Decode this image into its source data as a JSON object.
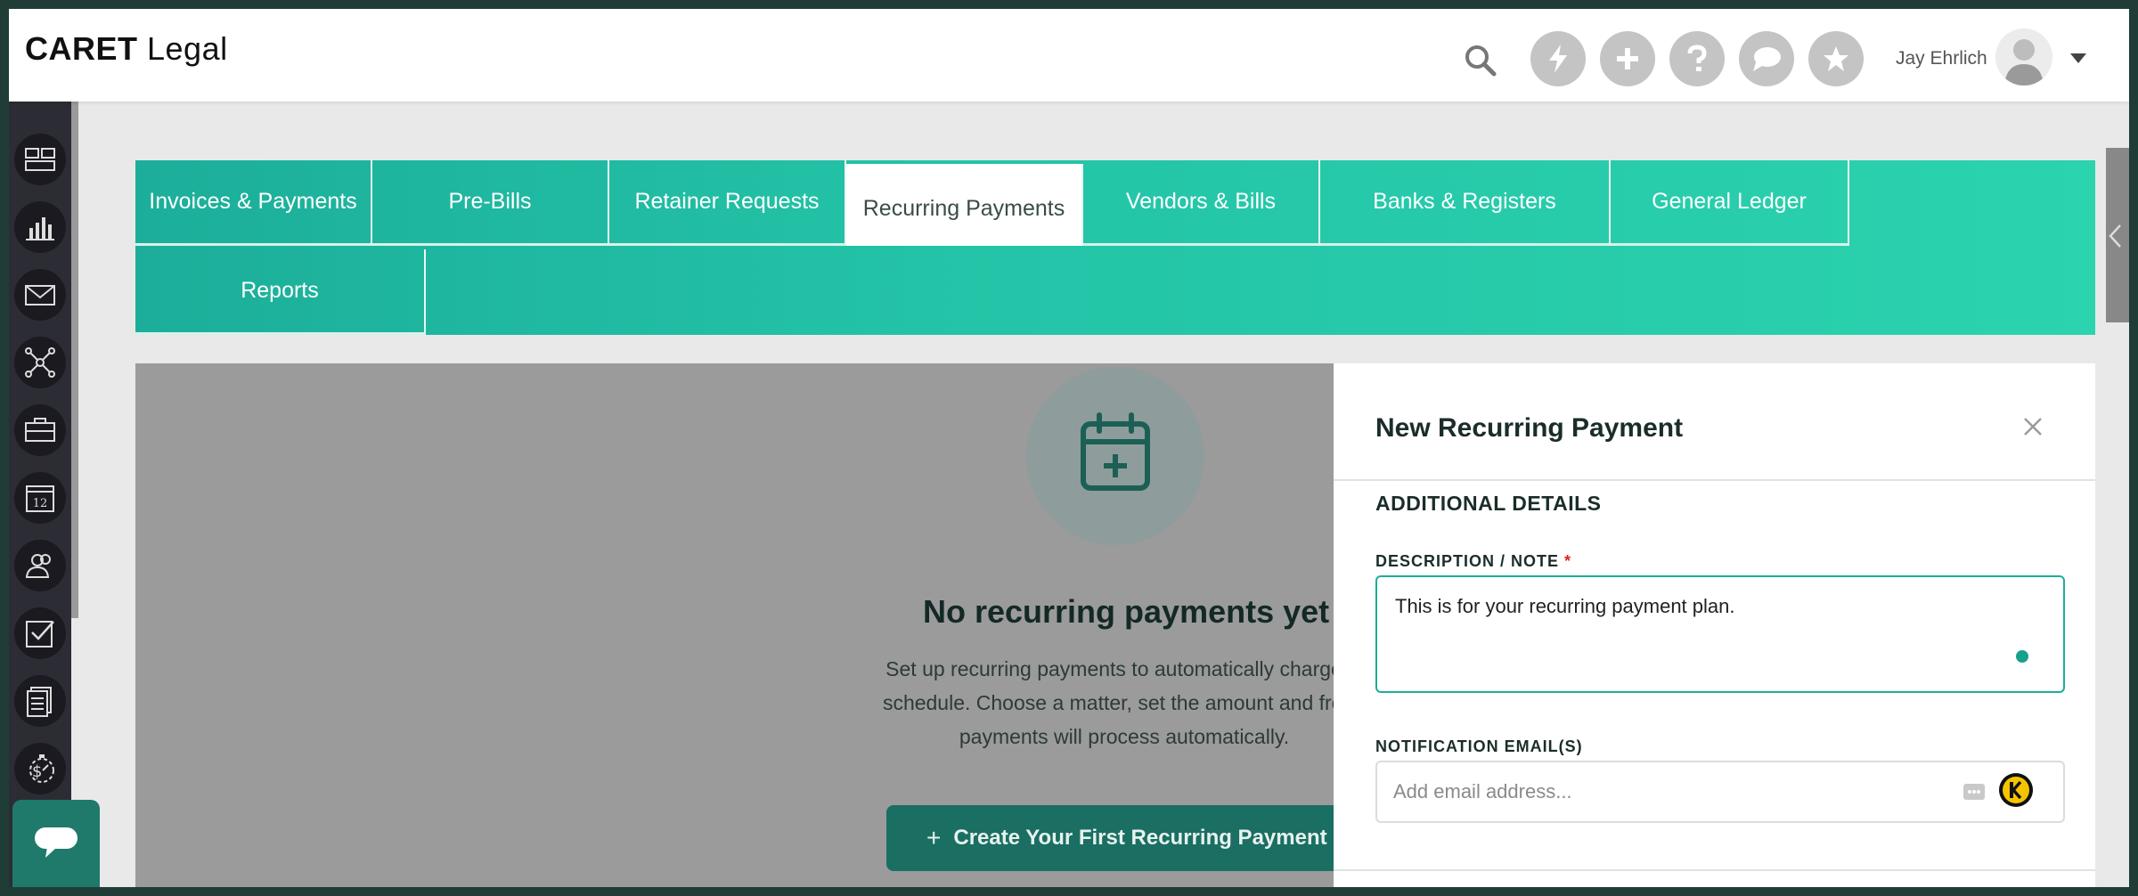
{
  "header": {
    "logo_text": "CARET Legal",
    "user_name": "Jay Ehrlich",
    "icons": [
      "search-icon",
      "lightning-icon",
      "plus-icon",
      "help-icon",
      "chat-icon",
      "star-icon"
    ]
  },
  "sidebar": {
    "items": [
      "dashboard-icon",
      "reports-chart-icon",
      "mail-icon",
      "network-icon",
      "briefcase-icon",
      "calendar-icon",
      "contacts-icon",
      "tasks-icon",
      "documents-icon",
      "billing-timer-icon"
    ],
    "calendar_day": "12"
  },
  "tabs": {
    "row1": [
      "Invoices & Payments",
      "Pre-Bills",
      "Retainer Requests",
      "Recurring Payments",
      "Vendors & Bills",
      "Banks & Registers",
      "General Ledger"
    ],
    "row2": [
      "Reports"
    ],
    "active": "Recurring Payments"
  },
  "empty_state": {
    "title": "No recurring payments yet",
    "description_lines": [
      "Set up recurring payments to automatically charge cl",
      "schedule. Choose a matter, set the amount and frequ",
      "payments will process automatically."
    ],
    "cta_label": "Create Your First Recurring Payment",
    "cta_prefix": "+"
  },
  "panel": {
    "title": "New Recurring Payment",
    "section": "ADDITIONAL DETAILS",
    "description_label": "DESCRIPTION / NOTE",
    "required_mark": "*",
    "description_value": "This is for your recurring payment plan.",
    "email_label": "NOTIFICATION EMAIL(S)",
    "email_placeholder": "Add email address..."
  },
  "colors": {
    "accent": "#1cae9a",
    "accent_dark": "#1b6e62",
    "sidebar": "#2c2c35"
  }
}
